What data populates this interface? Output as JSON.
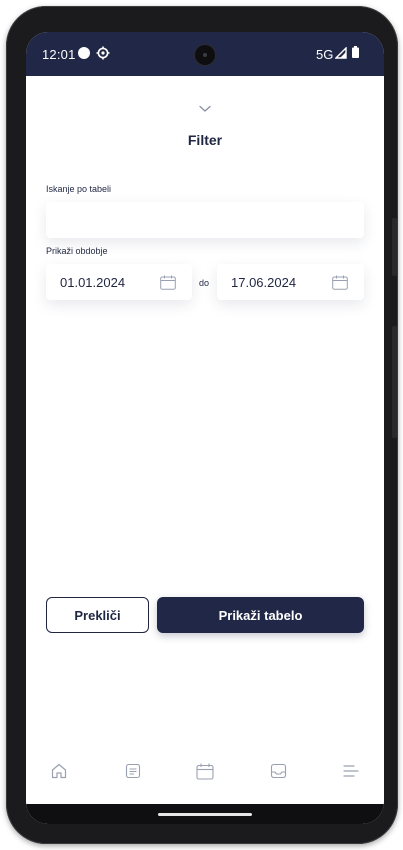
{
  "status_bar": {
    "time": "12:01",
    "network": "5G",
    "icons": [
      "record-dot-icon",
      "settings-gear-icon",
      "signal-icon",
      "battery-icon"
    ]
  },
  "sheet": {
    "title": "Filter",
    "collapse_icon": "chevron-down-icon"
  },
  "search": {
    "label": "Iskanje po tabeli",
    "value": "",
    "placeholder": ""
  },
  "period": {
    "label": "Prikaži obdobje",
    "from": "01.01.2024",
    "separator": "do",
    "to": "17.06.2024",
    "icon": "calendar-icon"
  },
  "actions": {
    "cancel_label": "Prekliči",
    "submit_label": "Prikaži tabelo"
  },
  "bottom_nav": {
    "items": [
      "home-icon",
      "document-icon",
      "calendar-icon",
      "inbox-icon",
      "menu-icon"
    ]
  },
  "colors": {
    "primary": "#212847",
    "text": "#1f2642",
    "nav_icon": "#9aa0b0"
  }
}
